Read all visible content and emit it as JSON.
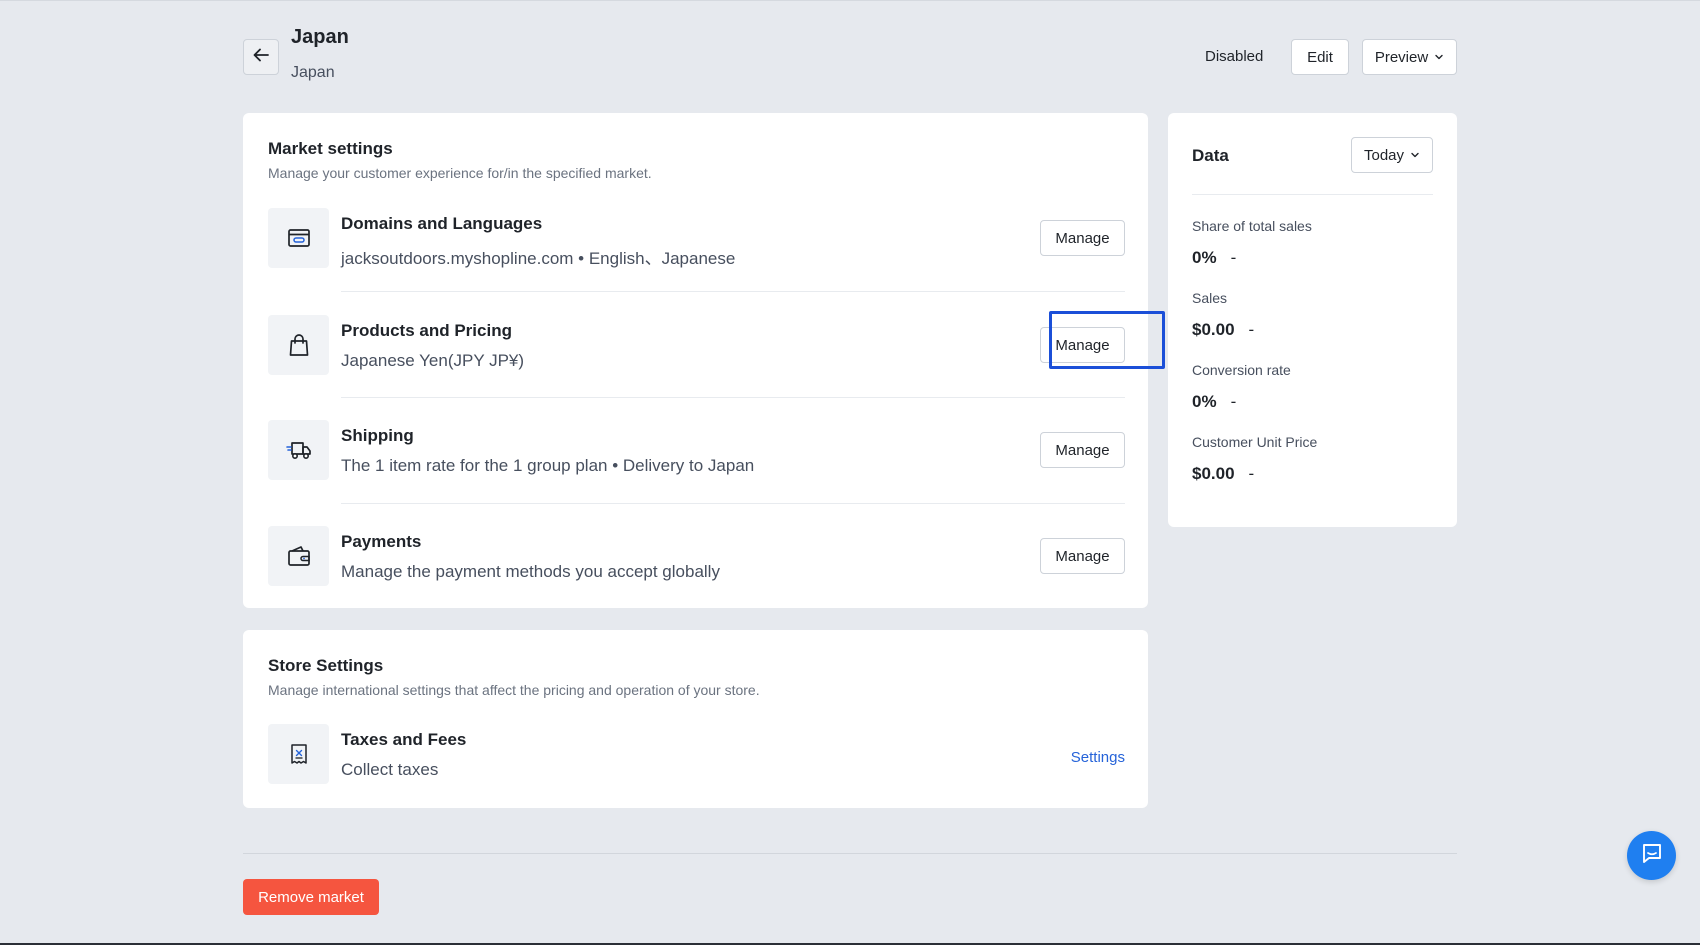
{
  "header": {
    "title": "Japan",
    "subtitle": "Japan",
    "status": "Disabled",
    "edit_label": "Edit",
    "preview_label": "Preview"
  },
  "market_settings": {
    "title": "Market settings",
    "description": "Manage your customer experience for/in the specified market.",
    "rows": [
      {
        "icon": "domain-icon",
        "title": "Domains and Languages",
        "description": "jacksoutdoors.myshopline.com • English、Japanese",
        "action": "Manage"
      },
      {
        "icon": "shopping-bag-icon",
        "title": "Products and Pricing",
        "description": "Japanese Yen(JPY JP¥)",
        "action": "Manage"
      },
      {
        "icon": "delivery-truck-icon",
        "title": "Shipping",
        "description": "The 1 item rate for the 1 group plan • Delivery to Japan",
        "action": "Manage"
      },
      {
        "icon": "wallet-icon",
        "title": "Payments",
        "description": "Manage the payment methods you accept globally",
        "action": "Manage"
      }
    ]
  },
  "store_settings": {
    "title": "Store Settings",
    "description": "Manage international settings that affect the pricing and operation of your store.",
    "rows": [
      {
        "icon": "receipt-icon",
        "title": "Taxes and Fees",
        "description": "Collect taxes",
        "action": "Settings"
      }
    ]
  },
  "data_panel": {
    "title": "Data",
    "period": "Today",
    "metrics": [
      {
        "label": "Share of total sales",
        "value": "0%",
        "trend": "-"
      },
      {
        "label": "Sales",
        "value": "$0.00",
        "trend": "-"
      },
      {
        "label": "Conversion rate",
        "value": "0%",
        "trend": "-"
      },
      {
        "label": "Customer Unit Price",
        "value": "$0.00",
        "trend": "-"
      }
    ]
  },
  "footer": {
    "remove_label": "Remove market"
  },
  "colors": {
    "background": "#e6e9ee",
    "accent": "#1b4fd8",
    "link": "#2563d9",
    "danger": "#f5553f",
    "chat": "#1f7ff0"
  },
  "icons": {
    "back": "arrow-left-icon",
    "chevron": "chevron-down-icon",
    "chat": "chat-icon"
  }
}
